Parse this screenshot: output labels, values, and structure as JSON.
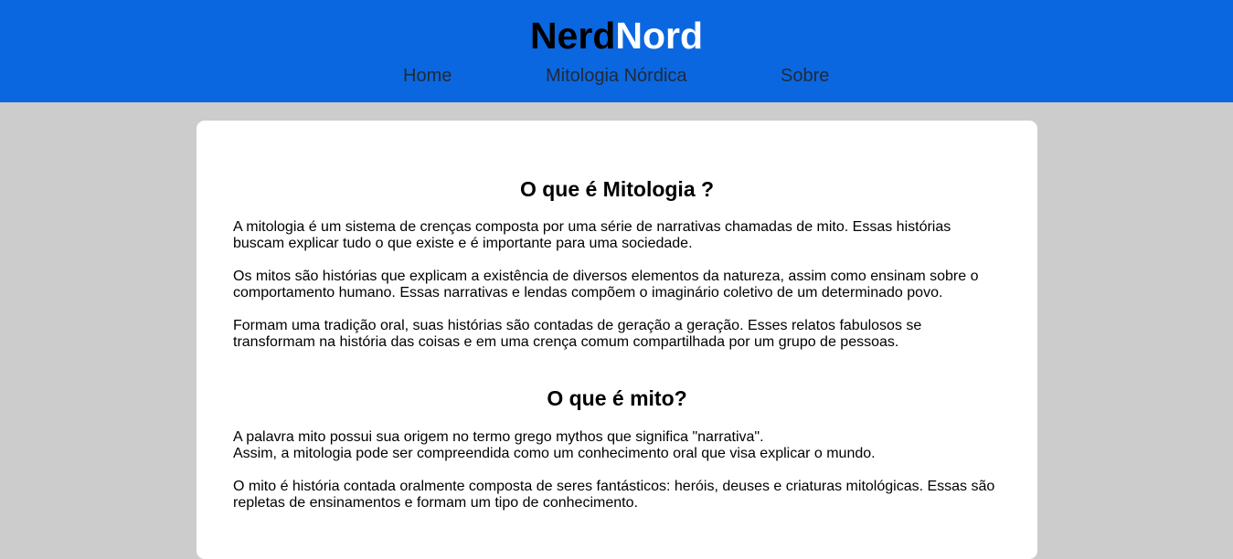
{
  "header": {
    "logo_part1": "Nerd",
    "logo_part2": "Nord",
    "nav": {
      "home": "Home",
      "mitologia": "Mitologia Nórdica",
      "sobre": "Sobre"
    },
    "colors": {
      "background": "#0b67df",
      "logo_dark": "#000000",
      "logo_light": "#ffffff"
    }
  },
  "content": {
    "section1": {
      "title": "O que é Mitologia ?",
      "paragraphs": [
        "A mitologia é um sistema de crenças composta por uma série de narrativas chamadas de mito. Essas histórias buscam explicar tudo o que existe e é importante para uma sociedade.",
        "Os mitos são histórias que explicam a existência de diversos elementos da natureza, assim como ensinam sobre o comportamento humano. Essas narrativas e lendas compõem o imaginário coletivo de um determinado povo.",
        "Formam uma tradição oral, suas histórias são contadas de geração a geração. Esses relatos fabulosos se transformam na história das coisas e em uma crença comum compartilhada por um grupo de pessoas."
      ]
    },
    "section2": {
      "title": "O que é mito?",
      "paragraphs": [
        "A palavra mito possui sua origem no termo grego mythos que significa \"narrativa\".",
        "Assim, a mitologia pode ser compreendida como um conhecimento oral que visa explicar o mundo.",
        "O mito é história contada oralmente composta de seres fantásticos: heróis, deuses e criaturas mitológicas. Essas são repletas de ensinamentos e formam um tipo de conhecimento."
      ]
    }
  },
  "page_background": "#cccccc"
}
